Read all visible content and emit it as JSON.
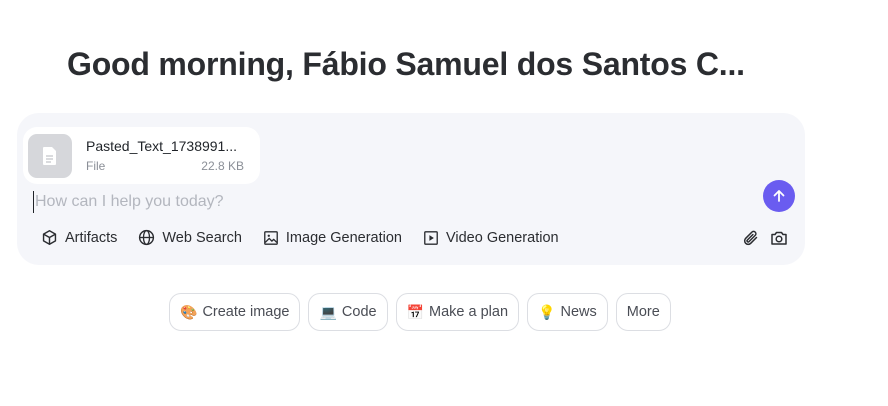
{
  "greeting": "Good morning, Fábio Samuel dos Santos C...",
  "attachment": {
    "name": "Pasted_Text_1738991...",
    "type": "File",
    "size": "22.8 KB"
  },
  "prompt": {
    "placeholder": "How can I help you today?",
    "value": ""
  },
  "tools": [
    {
      "label": "Artifacts",
      "icon": "cube-icon"
    },
    {
      "label": "Web Search",
      "icon": "globe-icon"
    },
    {
      "label": "Image Generation",
      "icon": "image-icon"
    },
    {
      "label": "Video Generation",
      "icon": "play-square-icon"
    }
  ],
  "actions": [
    {
      "icon": "paperclip-icon"
    },
    {
      "icon": "camera-icon"
    }
  ],
  "send": {
    "icon": "arrow-up-icon",
    "color": "#6a5cf0"
  },
  "suggestions": [
    {
      "emoji": "🎨",
      "label": "Create image"
    },
    {
      "emoji": "💻",
      "label": "Code"
    },
    {
      "emoji": "📅",
      "label": "Make a plan"
    },
    {
      "emoji": "💡",
      "label": "News"
    },
    {
      "emoji": "",
      "label": "More"
    }
  ]
}
